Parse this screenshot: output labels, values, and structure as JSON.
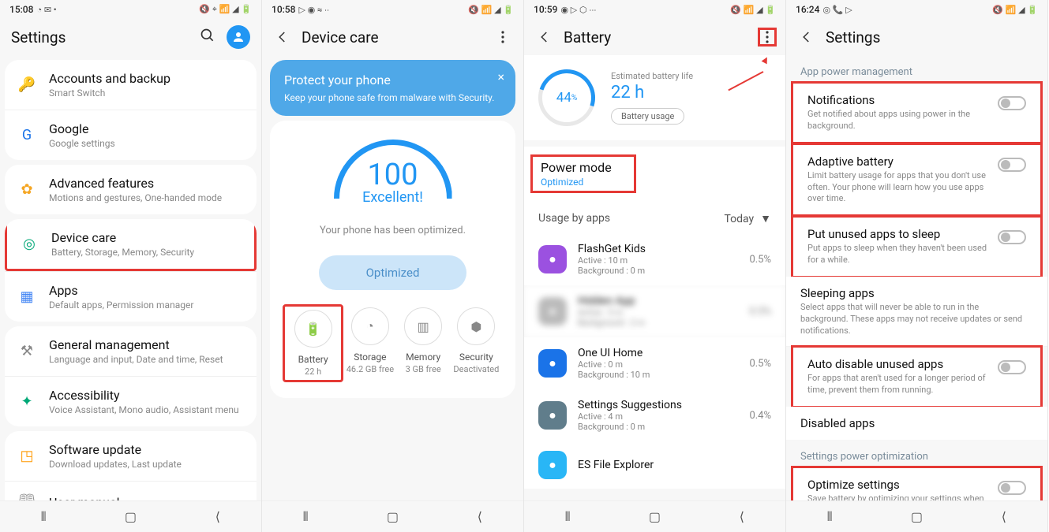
{
  "p1": {
    "status": {
      "time": "15:08",
      "left_icons": "◔ ✉ •",
      "right_icons": "🔇 ⌖ 📶 ◢ 🔋"
    },
    "header": {
      "title": "Settings"
    },
    "group1": [
      {
        "icon": "🔑",
        "color": "#1a73e8",
        "title": "Accounts and backup",
        "sub": "Smart Switch"
      },
      {
        "icon": "G",
        "color": "#1a73e8",
        "title": "Google",
        "sub": "Google settings"
      }
    ],
    "group2": [
      {
        "icon": "✿",
        "color": "#f5a623",
        "title": "Advanced features",
        "sub": "Motions and gestures, One-handed mode"
      }
    ],
    "group3": [
      {
        "icon": "◎",
        "color": "#00a877",
        "title": "Device care",
        "sub": "Battery, Storage, Memory, Security",
        "highlight": true
      },
      {
        "icon": "▦",
        "color": "#4285f4",
        "title": "Apps",
        "sub": "Default apps, Permission manager"
      }
    ],
    "group4": [
      {
        "icon": "⚒",
        "color": "#888",
        "title": "General management",
        "sub": "Language and input, Date and time, Reset"
      },
      {
        "icon": "✦",
        "color": "#00a877",
        "title": "Accessibility",
        "sub": "Voice Assistant, Mono audio, Assistant menu"
      }
    ],
    "group5": [
      {
        "icon": "◳",
        "color": "#ff9800",
        "title": "Software update",
        "sub": "Download updates, Last update"
      },
      {
        "icon": "🕮",
        "color": "#888",
        "title": "User manual",
        "sub": ""
      }
    ]
  },
  "p2": {
    "status": {
      "time": "10:58",
      "left_icons": "▷ ◉ ≈ ∙∙",
      "right_icons": "🔇 📶 ◢ 🔋"
    },
    "header": {
      "title": "Device care"
    },
    "banner": {
      "title": "Protect your phone",
      "sub": "Keep your phone safe from malware with Security."
    },
    "score": {
      "value": "100",
      "label": "Excellent!",
      "text": "Your phone has been optimized.",
      "button": "Optimized"
    },
    "tiles": [
      {
        "label": "Battery",
        "sub": "22 h",
        "icon": "🔋",
        "highlight": true
      },
      {
        "label": "Storage",
        "sub": "46.2 GB free",
        "icon": "◔"
      },
      {
        "label": "Memory",
        "sub": "3 GB free",
        "icon": "▥"
      },
      {
        "label": "Security",
        "sub": "Deactivated",
        "icon": "⬢"
      }
    ]
  },
  "p3": {
    "status": {
      "time": "10:59",
      "left_icons": "◉ ▷ ⬡ ∙∙∙",
      "right_icons": "🔇 📶 ◢ 🔋"
    },
    "header": {
      "title": "Battery"
    },
    "battery": {
      "pct": "44",
      "pct_unit": "%",
      "est_label": "Estimated battery life",
      "est_value": "22 h",
      "usage_btn": "Battery usage"
    },
    "power": {
      "title": "Power mode",
      "value": "Optimized"
    },
    "usage": {
      "label": "Usage by apps",
      "filter": "Today"
    },
    "apps": [
      {
        "name": "FlashGet Kids",
        "active": "Active : 10 m",
        "bg": "Background : 0 m",
        "pct": "0.5%",
        "bgcolor": "#9b51e0"
      },
      {
        "name": "Hidden App",
        "active": "Active : 5 m",
        "bg": "Background : 2 m",
        "pct": "0.5%",
        "bgcolor": "#bbb",
        "blur": true
      },
      {
        "name": "One UI Home",
        "active": "Active : 0 m",
        "bg": "Background : 10 m",
        "pct": "0.5%",
        "bgcolor": "#1a73e8"
      },
      {
        "name": "Settings Suggestions",
        "active": "Active : 4 m",
        "bg": "Background : 0 m",
        "pct": "0.4%",
        "bgcolor": "#607d8b"
      },
      {
        "name": "ES File Explorer",
        "active": "",
        "bg": "",
        "pct": "",
        "bgcolor": "#29b6f6"
      }
    ]
  },
  "p4": {
    "status": {
      "time": "16:24",
      "left_icons": "◎ 📞 ▷",
      "right_icons": "🔇 📶 ◢ 🔋"
    },
    "header": {
      "title": "Settings"
    },
    "section1_h": "App power management",
    "items1": [
      {
        "title": "Notifications",
        "sub": "Get notified about apps using power in the background.",
        "highlight": true
      },
      {
        "title": "Adaptive battery",
        "sub": "Limit battery usage for apps that you don't use often. Your phone will learn how you use apps over time.",
        "highlight": true
      },
      {
        "title": "Put unused apps to sleep",
        "sub": "Put apps to sleep when they haven't been used for a while.",
        "highlight": true
      },
      {
        "title": "Sleeping apps",
        "sub": "Select apps that will never be able to run in the background. These apps may not receive updates or send notifications."
      },
      {
        "title": "Auto disable unused apps",
        "sub": "For apps that aren't used for a longer period of time, prevent them from running.",
        "highlight": true
      },
      {
        "title": "Disabled apps",
        "sub": ""
      }
    ],
    "section2_h": "Settings power optimization",
    "items2": [
      {
        "title": "Optimize settings",
        "sub": "Save battery by optimizing your settings when you're not using your phone.",
        "highlight": true
      }
    ]
  }
}
